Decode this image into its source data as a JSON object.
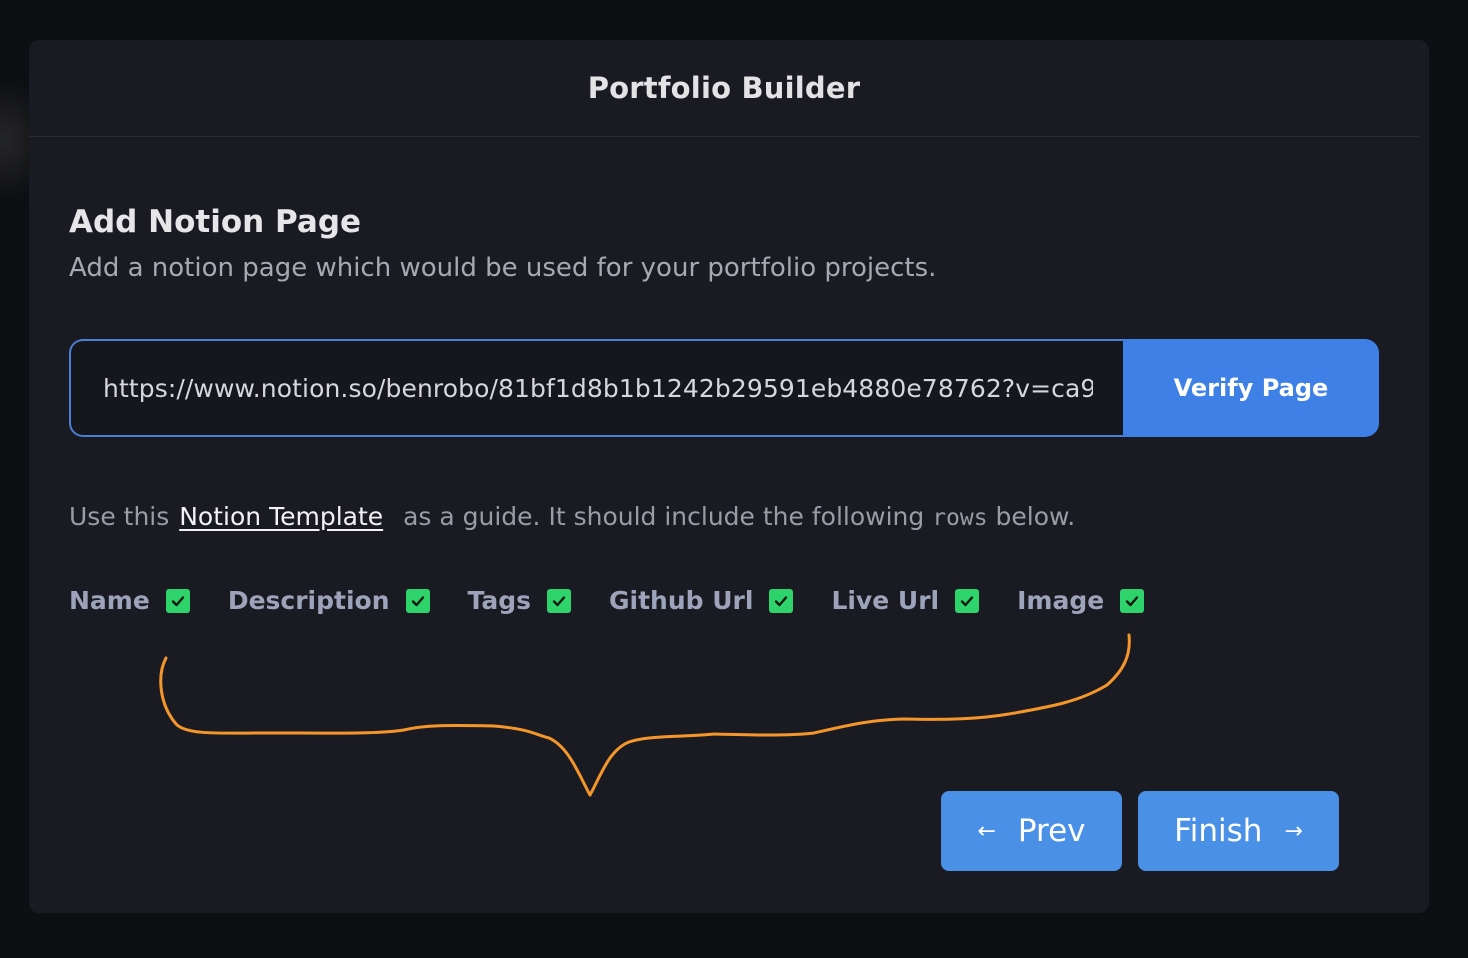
{
  "modal": {
    "title": "Portfolio Builder"
  },
  "section": {
    "title": "Add Notion Page",
    "subtitle": "Add a notion page which would be used for your portfolio projects."
  },
  "url_input": {
    "value": "https://www.notion.so/benrobo/81bf1d8b1b1242b29591eb4880e78762?v=ca9"
  },
  "verify_button": {
    "label": "Verify Page"
  },
  "guide": {
    "prefix": "Use this",
    "link_label": "Notion Template",
    "middle": "as a guide. It should include the following",
    "code_word": "rows",
    "suffix": "below."
  },
  "fields": [
    {
      "label": "Name",
      "checked": true
    },
    {
      "label": "Description",
      "checked": true
    },
    {
      "label": "Tags",
      "checked": true
    },
    {
      "label": "Github Url",
      "checked": true
    },
    {
      "label": "Live Url",
      "checked": true
    },
    {
      "label": "Image",
      "checked": true
    }
  ],
  "nav": {
    "prev_label": "Prev",
    "finish_label": "Finish",
    "prev_icon": "arrow-left-icon",
    "finish_icon": "arrow-right-icon"
  },
  "colors": {
    "accent": "#3f80e6",
    "check": "#2fd36b",
    "annotation": "#f5962a",
    "panel": "#1a1b22"
  }
}
